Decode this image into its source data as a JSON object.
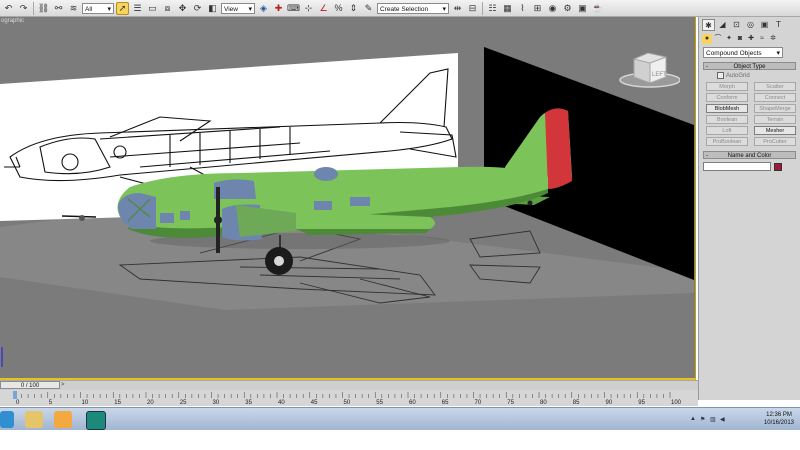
{
  "toolbar": {
    "selection_filter": "All",
    "reference_coord": "View",
    "named_selection_set": "Create Selection Set"
  },
  "viewport": {
    "label": "ographic",
    "viewcube_face": "LEFT"
  },
  "command_panel": {
    "category": "Compound Objects",
    "object_type_title": "Object Type",
    "autogrid_label": "AutoGrid",
    "buttons": [
      {
        "label": "Morph",
        "enabled": false
      },
      {
        "label": "Scatter",
        "enabled": false
      },
      {
        "label": "Conform",
        "enabled": false
      },
      {
        "label": "Connect",
        "enabled": false
      },
      {
        "label": "BlobMesh",
        "enabled": true
      },
      {
        "label": "ShapeMerge",
        "enabled": false
      },
      {
        "label": "Boolean",
        "enabled": false
      },
      {
        "label": "Terrain",
        "enabled": false
      },
      {
        "label": "Loft",
        "enabled": false
      },
      {
        "label": "Mesher",
        "enabled": true
      },
      {
        "label": "ProBoolean",
        "enabled": false
      },
      {
        "label": "ProCutter",
        "enabled": false
      }
    ],
    "name_color_title": "Name and Color",
    "object_color": "#a0183a"
  },
  "timeline": {
    "frame_counter": "0 / 100",
    "next_arrow": ">",
    "ticks": [
      "0",
      "5",
      "10",
      "15",
      "20",
      "25",
      "30",
      "35",
      "40",
      "45",
      "50",
      "55",
      "60",
      "65",
      "70",
      "75",
      "80",
      "85",
      "90",
      "95",
      "100"
    ]
  },
  "taskbar": {
    "time": "12:36 PM",
    "date": "10/16/2013"
  },
  "colors": {
    "plane_body": "#7cc45a",
    "plane_tail": "#d3363a",
    "plane_windows": "#6e86ad",
    "viewport_bg": "#7b7b7b"
  }
}
